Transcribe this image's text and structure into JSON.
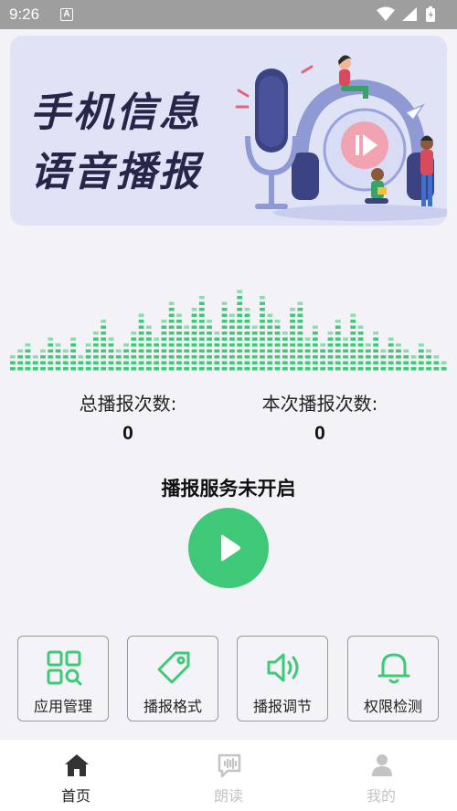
{
  "status_bar": {
    "time": "9:26",
    "notification_letter": "A"
  },
  "banner": {
    "title_line1": "手机信息",
    "title_line2": "语音播报"
  },
  "equalizer": {
    "levels": [
      3,
      4,
      5,
      3,
      4,
      6,
      5,
      4,
      6,
      3,
      5,
      7,
      9,
      6,
      4,
      5,
      7,
      10,
      8,
      6,
      9,
      12,
      10,
      8,
      11,
      13,
      9,
      7,
      12,
      10,
      14,
      11,
      8,
      13,
      10,
      9,
      7,
      11,
      12,
      6,
      8,
      5,
      7,
      9,
      6,
      10,
      8,
      5,
      7,
      4,
      6,
      5,
      4,
      3,
      5,
      4,
      3,
      2
    ],
    "color": "#3ec878"
  },
  "stats": {
    "total_label": "总播报次数:",
    "total_value": "0",
    "current_label": "本次播报次数:",
    "current_value": "0"
  },
  "service_status": "播报服务未开启",
  "accent_color": "#3ec878",
  "functions": [
    {
      "label": "应用管理",
      "icon": "app-grid-search-icon"
    },
    {
      "label": "播报格式",
      "icon": "tag-icon"
    },
    {
      "label": "播报调节",
      "icon": "volume-icon"
    },
    {
      "label": "权限检测",
      "icon": "bell-icon"
    }
  ],
  "tabs": [
    {
      "label": "首页",
      "icon": "home-icon",
      "active": true
    },
    {
      "label": "朗读",
      "icon": "voice-message-icon",
      "active": false
    },
    {
      "label": "我的",
      "icon": "user-icon",
      "active": false
    }
  ]
}
